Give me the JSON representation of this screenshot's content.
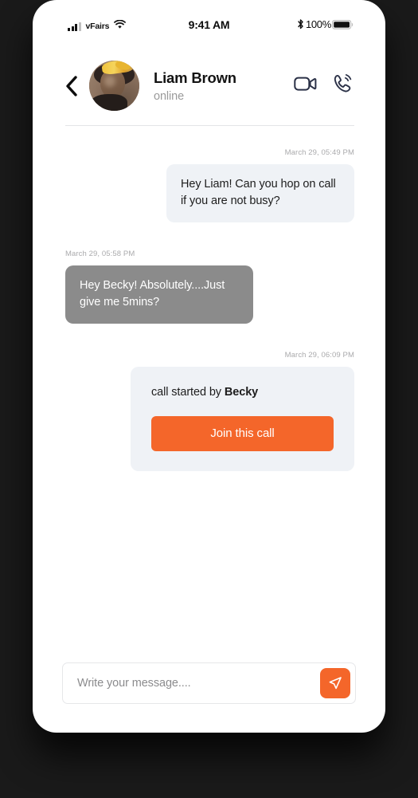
{
  "status_bar": {
    "carrier": "vFairs",
    "time": "9:41 AM",
    "battery_percent": "100%",
    "signal_icon": "signal-bars-icon",
    "wifi_icon": "wifi-icon",
    "bluetooth_icon": "bluetooth-icon",
    "battery_icon": "battery-full-icon"
  },
  "header": {
    "back_icon": "chevron-left-icon",
    "avatar_icon": "contact-avatar",
    "contact_name": "Liam Brown",
    "contact_status": "online",
    "video_call_icon": "video-camera-icon",
    "voice_call_icon": "phone-call-icon"
  },
  "messages": [
    {
      "direction": "out",
      "timestamp": "March 29, 05:49 PM",
      "text": "Hey Liam! Can you hop on call if you are not busy?"
    },
    {
      "direction": "in",
      "timestamp": "March 29, 05:58 PM",
      "text": "Hey Becky! Absolutely....Just give me 5mins?"
    }
  ],
  "call_card": {
    "timestamp": "March 29, 06:09 PM",
    "label_prefix": "call started by ",
    "starter_name": "Becky",
    "join_button_label": "Join this call"
  },
  "composer": {
    "placeholder": "Write your message....",
    "value": "",
    "send_icon": "send-paper-plane-icon"
  },
  "colors": {
    "accent": "#f4662a",
    "incoming_bubble": "#8b8b8b",
    "outgoing_bubble": "#eff2f6",
    "icon_navy": "#2b3147",
    "timestamp_gray": "#aaaaac"
  }
}
